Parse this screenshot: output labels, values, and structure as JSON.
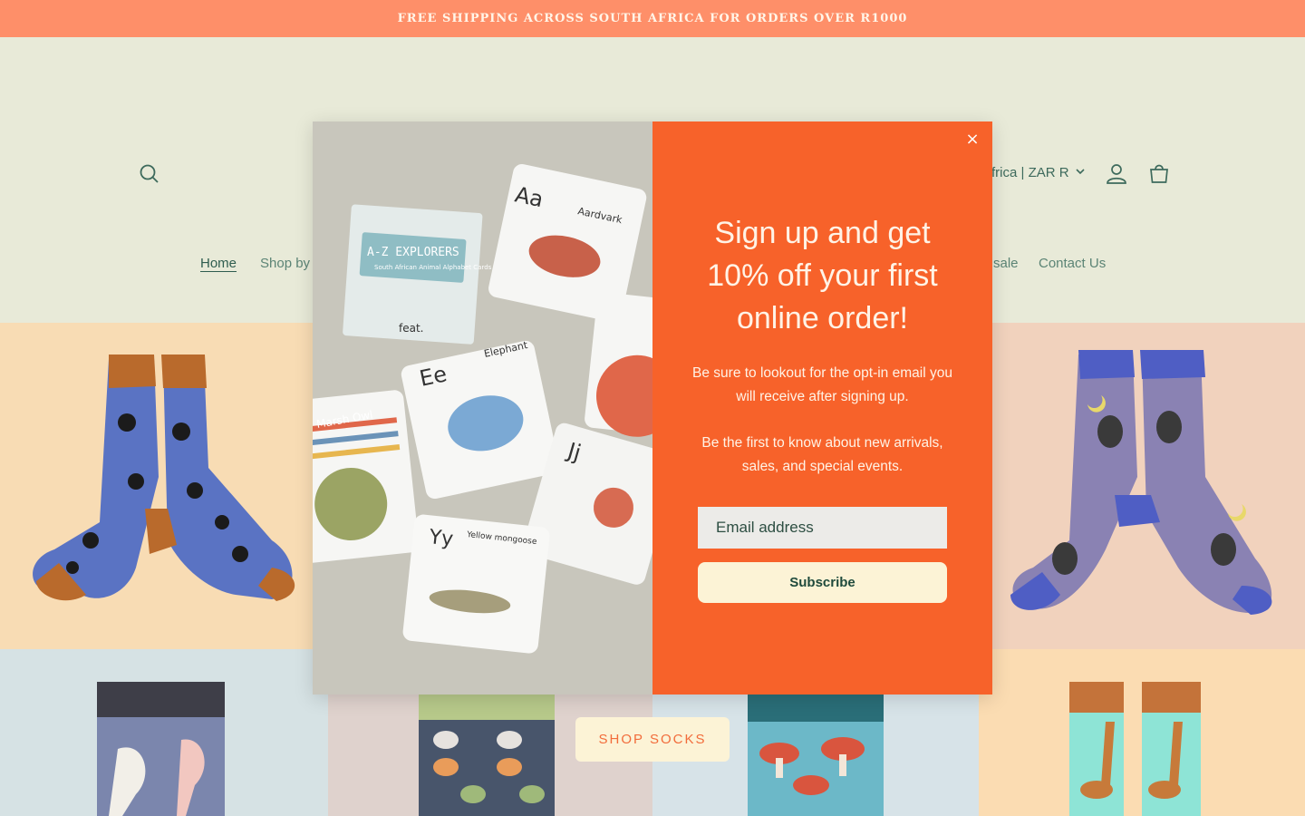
{
  "announcement": {
    "text": "FREE SHIPPING ACROSS SOUTH AFRICA FOR ORDERS OVER R1000"
  },
  "header": {
    "country_selector": "frica | ZAR R",
    "nav": [
      {
        "label": "Home"
      },
      {
        "label": "Shop by"
      },
      {
        "label": "sale"
      },
      {
        "label": "Contact Us"
      }
    ]
  },
  "hero": {
    "shop_button": "SHOP SOCKS"
  },
  "popup": {
    "title": "Sign up and get 10% off your first online order!",
    "text_1": "Be sure to lookout for the opt-in email you will receive after signing up.",
    "text_2": "Be the first to know about new arrivals, sales, and special events.",
    "email_placeholder": "Email address",
    "subscribe_label": "Subscribe",
    "close_label": "×",
    "image_card_text": {
      "box_title": "A-Z EXPLORERS",
      "box_subtitle": "South African Animal Alphabet Cards",
      "brand": "feat.",
      "card_a_letter": "Aa",
      "card_a_word": "Aardvark",
      "card_e_letter": "Ee",
      "card_e_word": "Elephant",
      "card_j_letter": "Jj",
      "card_y_letter": "Yy",
      "card_y_word": "Yellow mongoose",
      "card_marsh": "Marsh Owl"
    }
  },
  "colors": {
    "announcement_bg": "#fe8f69",
    "header_bg": "#e8ead8",
    "popup_bg": "#f7622a",
    "button_bg": "#fcf3d6",
    "accent_text": "#3d6a5c"
  }
}
